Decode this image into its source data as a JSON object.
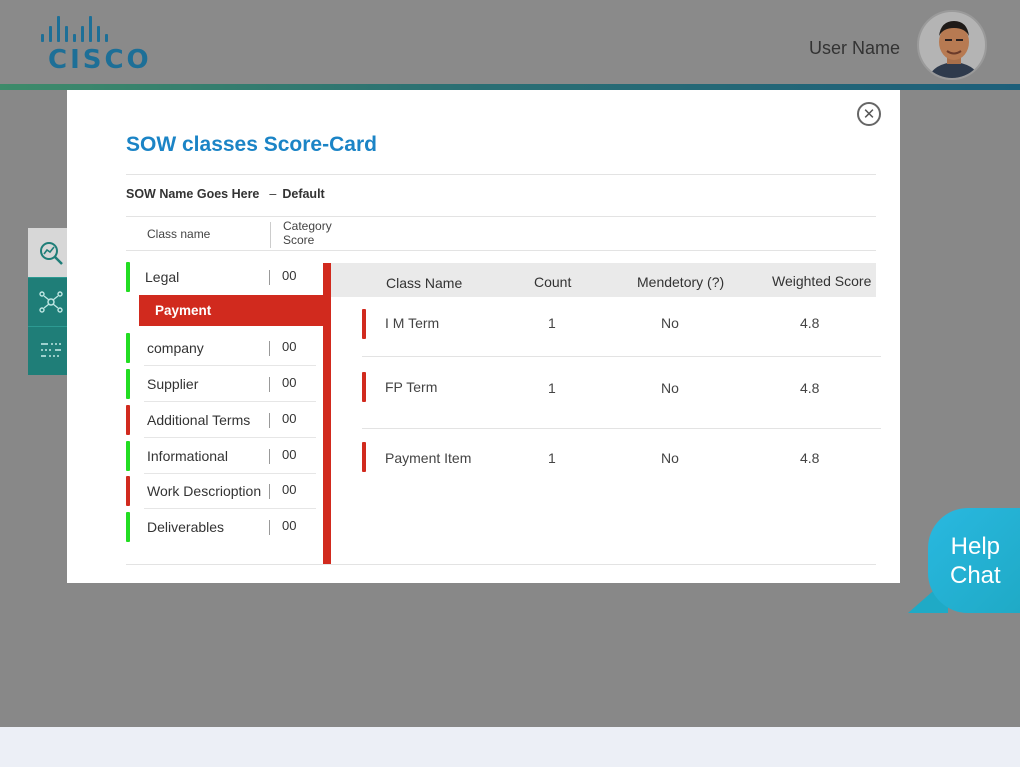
{
  "header": {
    "logo_text": "CISCO",
    "user_name": "User Name",
    "brand_color": "#1d6f97"
  },
  "modal": {
    "title": "SOW classes Score-Card",
    "sow_name": "SOW Name Goes Here",
    "sow_separator": "–",
    "sow_variant": "Default",
    "close_icon": "close-icon",
    "left_columns": {
      "class_name": "Class name",
      "category_score": "Category Score"
    },
    "classes": [
      {
        "name": "Legal",
        "score": "00",
        "status": "green",
        "status_color": "#22dd22"
      },
      {
        "name": "Payment",
        "selected": true,
        "selected_color": "#d12a1e"
      },
      {
        "name": "company",
        "score": "00",
        "status": "green",
        "status_color": "#22dd22"
      },
      {
        "name": "Supplier",
        "score": "00",
        "status": "green",
        "status_color": "#22dd22"
      },
      {
        "name": "Additional Terms",
        "score": "00",
        "status": "red",
        "status_color": "#d12a1e"
      },
      {
        "name": "Informational",
        "score": "00",
        "status": "green",
        "status_color": "#22dd22"
      },
      {
        "name": "Work Descrioption",
        "score": "00",
        "status": "red",
        "status_color": "#d12a1e"
      },
      {
        "name": "Deliverables",
        "score": "00",
        "status": "green",
        "status_color": "#22dd22"
      }
    ],
    "detail_columns": {
      "class_name": "Class Name",
      "count": "Count",
      "mandatory": "Mendetory (?)",
      "weighted_score": "Weighted Score"
    },
    "detail_rows": [
      {
        "class_name": "I M Term",
        "count": "1",
        "mandatory": "No",
        "weighted_score": "4.8"
      },
      {
        "class_name": "FP Term",
        "count": "1",
        "mandatory": "No",
        "weighted_score": "4.8"
      },
      {
        "class_name": "Payment Item",
        "count": "1",
        "mandatory": "No",
        "weighted_score": "4.8"
      }
    ]
  },
  "side_rail": {
    "items": [
      {
        "icon": "analytics-search-icon"
      },
      {
        "icon": "network-icon"
      },
      {
        "icon": "list-filter-icon"
      }
    ]
  },
  "help_chat": {
    "line1": "Help",
    "line2": "Chat"
  }
}
